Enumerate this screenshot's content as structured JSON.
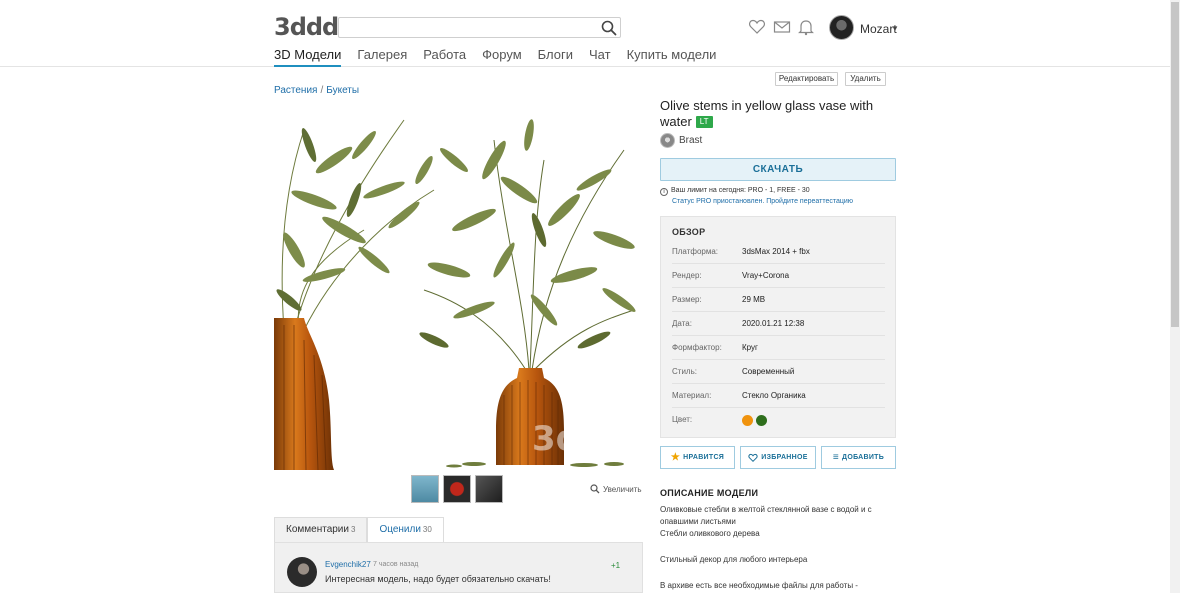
{
  "header": {
    "logo": "3ddd",
    "search_placeholder": "",
    "username": "Mozart",
    "icons": [
      "heart-icon",
      "mail-icon",
      "bell-icon",
      "search-icon"
    ]
  },
  "nav": {
    "items": [
      {
        "label": "3D Модели",
        "active": true
      },
      {
        "label": "Галерея"
      },
      {
        "label": "Работа"
      },
      {
        "label": "Форум"
      },
      {
        "label": "Блоги"
      },
      {
        "label": "Чат"
      },
      {
        "label": "Купить модели"
      }
    ]
  },
  "admin": {
    "edit_label": "Редактировать",
    "delete_label": "Удалить"
  },
  "breadcrumb": {
    "items": [
      "Растения",
      "Букеты"
    ],
    "separator": "/"
  },
  "gallery": {
    "zoom_label": "Увеличить",
    "thumbnails": 3
  },
  "comments": {
    "tab_comments": "Комментарии",
    "tab_comments_count": "3",
    "tab_rated": "Оценили",
    "tab_rated_count": "30",
    "items": [
      {
        "author": "Evgenchik27",
        "time": "7 часов назад",
        "vote": "+1",
        "text": "Интересная модель, надо будет обязательно скачать!"
      }
    ]
  },
  "model": {
    "title": "Olive stems in yellow glass vase with water",
    "badge": "LT",
    "author": "Brast",
    "download_label": "СКАЧАТЬ",
    "limit_text": "Ваш лимит на сегодня: PRO - 1, FREE - 30",
    "limit_link": "Статус PRO приостановлен. Пройдите переаттестацию"
  },
  "overview": {
    "title": "ОБЗОР",
    "rows": [
      {
        "key": "Платформа:",
        "value": "3dsMax 2014 + fbx"
      },
      {
        "key": "Рендер:",
        "value": "Vray+Corona"
      },
      {
        "key": "Размер:",
        "value": "29 MB"
      },
      {
        "key": "Дата:",
        "value": "2020.01.21 12:38"
      },
      {
        "key": "Формфактор:",
        "value": "Круг"
      },
      {
        "key": "Стиль:",
        "value": "Современный"
      },
      {
        "key": "Материал:",
        "value": "Стекло Органика"
      },
      {
        "key": "Цвет:",
        "value": ""
      }
    ],
    "colors": [
      "#f0930d",
      "#2e6e1c"
    ]
  },
  "actions": {
    "like_label": "НРАВИТСЯ",
    "favorite_label": "ИЗБРАННОЕ",
    "add_label": "ДОБАВИТЬ"
  },
  "description": {
    "title": "ОПИСАНИЕ МОДЕЛИ",
    "p1": "Оливковые стебли в желтой стеклянной вазе с водой и с опавшими листьями",
    "p2": "Стебли оливкового дерева",
    "p3": "Стильный декор для любого интерьера",
    "p4": "В архиве есть все необходимые файлы для работы -"
  },
  "accent_color": "#1f8fbf"
}
